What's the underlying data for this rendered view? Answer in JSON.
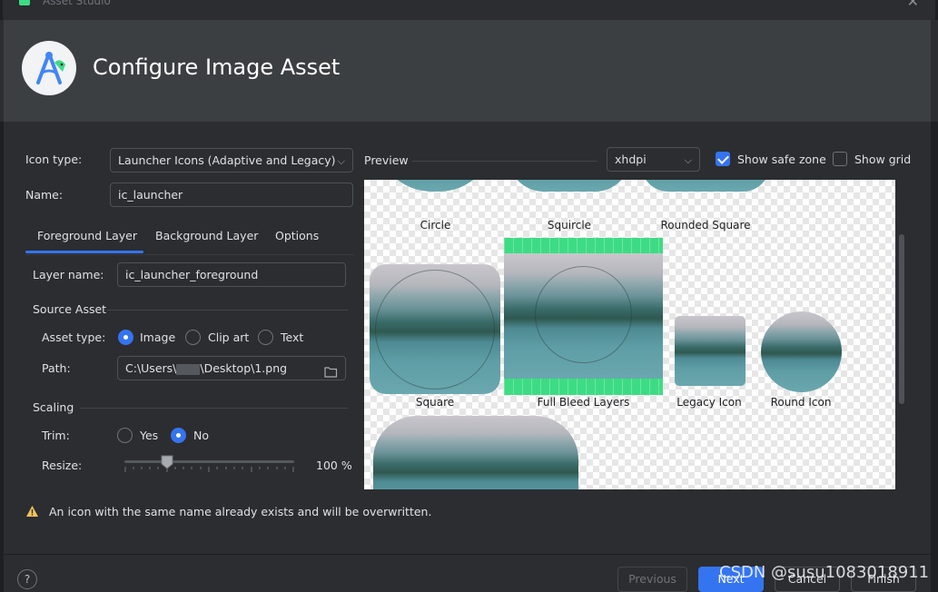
{
  "window": {
    "title": "Asset Studio"
  },
  "header": {
    "title": "Configure Image Asset"
  },
  "form": {
    "icon_type_label": "Icon type:",
    "icon_type_value": "Launcher Icons (Adaptive and Legacy)",
    "name_label": "Name:",
    "name_value": "ic_launcher"
  },
  "tabs": [
    {
      "label": "Foreground Layer",
      "selected": true
    },
    {
      "label": "Background Layer",
      "selected": false
    },
    {
      "label": "Options",
      "selected": false
    }
  ],
  "foreground": {
    "layer_name_label": "Layer name:",
    "layer_name_value": "ic_launcher_foreground",
    "source_asset_heading": "Source Asset",
    "asset_type_label": "Asset type:",
    "asset_types": [
      {
        "label": "Image",
        "selected": true
      },
      {
        "label": "Clip art",
        "selected": false
      },
      {
        "label": "Text",
        "selected": false
      }
    ],
    "path_label": "Path:",
    "path_value_prefix": "C:\\Users\\",
    "path_value_suffix": "\\Desktop\\1.png",
    "scaling_heading": "Scaling",
    "trim_label": "Trim:",
    "trim_options": [
      {
        "label": "Yes",
        "selected": false
      },
      {
        "label": "No",
        "selected": true
      }
    ],
    "resize_label": "Resize:",
    "resize_value": 100,
    "resize_text": "100 %"
  },
  "preview": {
    "label": "Preview",
    "density_value": "xhdpi",
    "show_safe_zone_label": "Show safe zone",
    "show_safe_zone": true,
    "show_grid_label": "Show grid",
    "show_grid": false,
    "captions": {
      "circle": "Circle",
      "squircle": "Squircle",
      "rounded_square": "Rounded Square",
      "square": "Square",
      "full_bleed": "Full Bleed Layers",
      "legacy": "Legacy Icon",
      "round": "Round Icon"
    }
  },
  "warning": {
    "text": "An icon with the same name already exists and will be overwritten."
  },
  "footer": {
    "help": "?",
    "previous": "Previous",
    "next": "Next",
    "cancel": "Cancel",
    "finish": "Finish"
  },
  "watermark": "CSDN @susu1083018911",
  "colors": {
    "accent": "#3574f0",
    "background": "#2b2d30",
    "header": "#3c3f41",
    "warning": "#f2c55c",
    "green": "#3ddc84"
  }
}
